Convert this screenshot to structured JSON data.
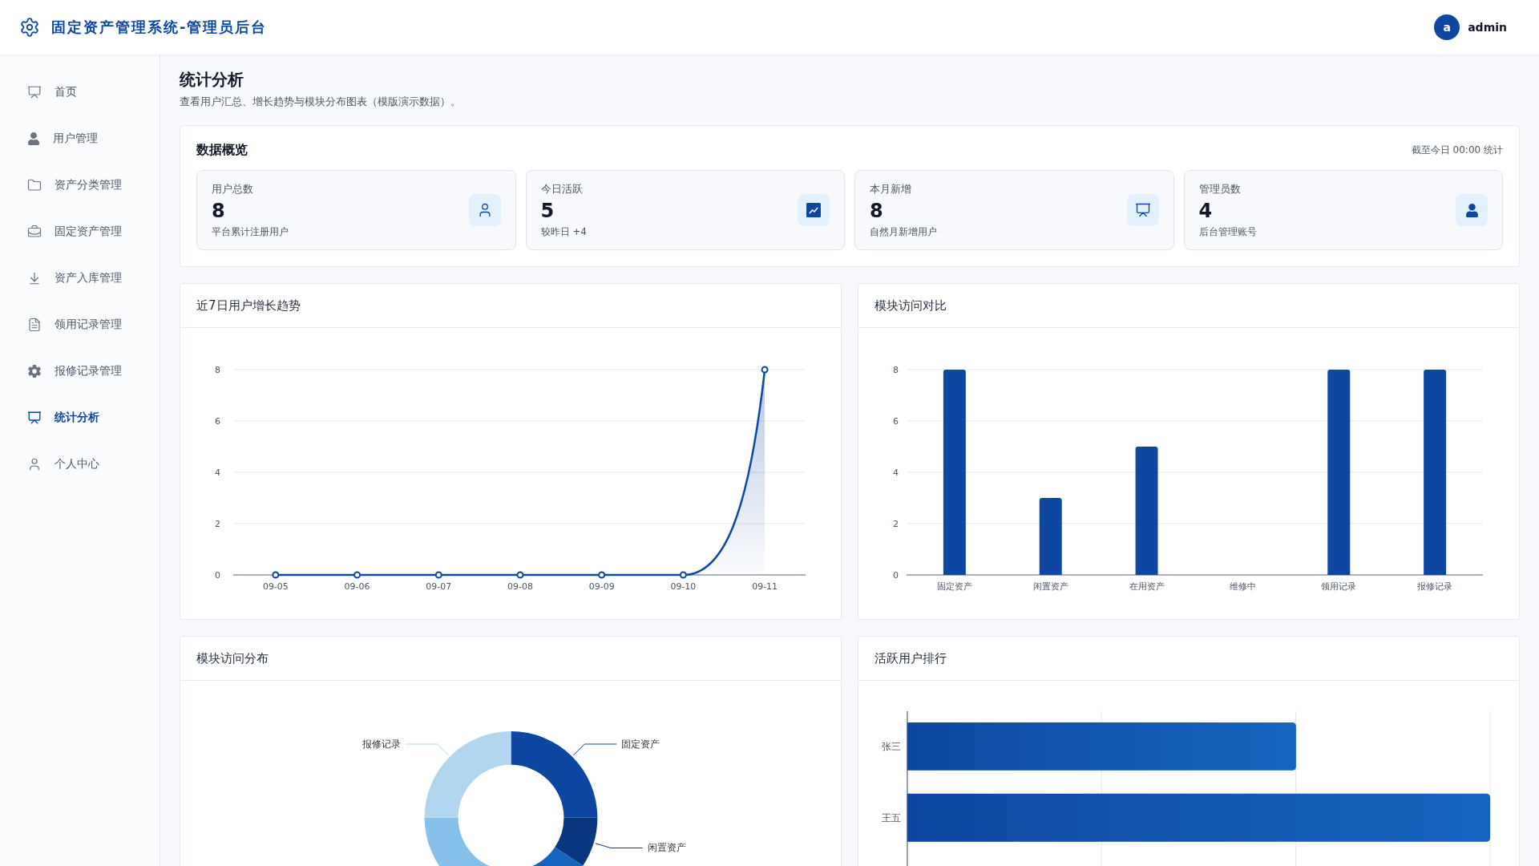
{
  "header": {
    "title": "固定资产管理系统-管理员后台",
    "user": {
      "avatar": "a",
      "name": "admin"
    }
  },
  "sidebar": {
    "items": [
      {
        "label": "首页",
        "selected": false
      },
      {
        "label": "用户管理",
        "selected": false
      },
      {
        "label": "资产分类管理",
        "selected": false
      },
      {
        "label": "固定资产管理",
        "selected": false
      },
      {
        "label": "资产入库管理",
        "selected": false
      },
      {
        "label": "领用记录管理",
        "selected": false
      },
      {
        "label": "报修记录管理",
        "selected": false
      },
      {
        "label": "统计分析",
        "selected": true
      },
      {
        "label": "个人中心",
        "selected": false
      }
    ]
  },
  "page": {
    "title": "统计分析",
    "subtitle": "查看用户汇总、增长趋势与模块分布图表（模版演示数据）。"
  },
  "overview": {
    "title": "数据概览",
    "note": "截至今日 00:00 统计",
    "stats": [
      {
        "label": "用户总数",
        "value": "8",
        "hint": "平台累计注册用户"
      },
      {
        "label": "今日活跃",
        "value": "5",
        "hint": "较昨日 +4"
      },
      {
        "label": "本月新增",
        "value": "8",
        "hint": "自然月新增用户"
      },
      {
        "label": "管理员数",
        "value": "4",
        "hint": "后台管理账号"
      }
    ]
  },
  "growth": {
    "title": "近7日用户增长趋势",
    "chart_data": {
      "type": "area",
      "categories": [
        "09-05",
        "09-06",
        "09-07",
        "09-08",
        "09-09",
        "09-10",
        "09-11"
      ],
      "series": [
        {
          "color": "#0d47a1",
          "values": [
            0,
            0,
            0,
            0,
            0,
            0,
            8
          ]
        }
      ],
      "ylim": [
        0,
        8
      ],
      "yticks": [
        0,
        2,
        4,
        6,
        8
      ],
      "grid": true
    }
  },
  "modules": {
    "title": "模块访问对比",
    "chart_data": {
      "type": "bar",
      "categories": [
        "固定资产",
        "闲置资产",
        "在用资产",
        "维修中",
        "领用记录",
        "报修记录"
      ],
      "series": [
        {
          "color": "#0d47a1",
          "values": [
            8,
            3,
            5,
            0,
            8,
            8
          ]
        }
      ],
      "ylim": [
        0,
        8
      ],
      "yticks": [
        0,
        2,
        4,
        6,
        8
      ],
      "grid": true
    }
  },
  "distribution": {
    "title": "模块访问分布",
    "chart_data": {
      "type": "donut",
      "categories": [
        "固定资产",
        "闲置资产",
        null,
        null,
        "报修记录"
      ],
      "series": [
        {
          "values": [
            25,
            9.375,
            15.625,
            25,
            25
          ]
        }
      ],
      "colors": [
        "#0d47a1",
        "#0a3880",
        "#1565c0",
        "#87c1ea",
        "#b0d6f0"
      ]
    }
  },
  "ranking": {
    "title": "活跃用户排行",
    "rows": [
      {
        "name": "张三",
        "level": 0.667
      },
      {
        "name": "王五",
        "level": 1
      }
    ]
  }
}
